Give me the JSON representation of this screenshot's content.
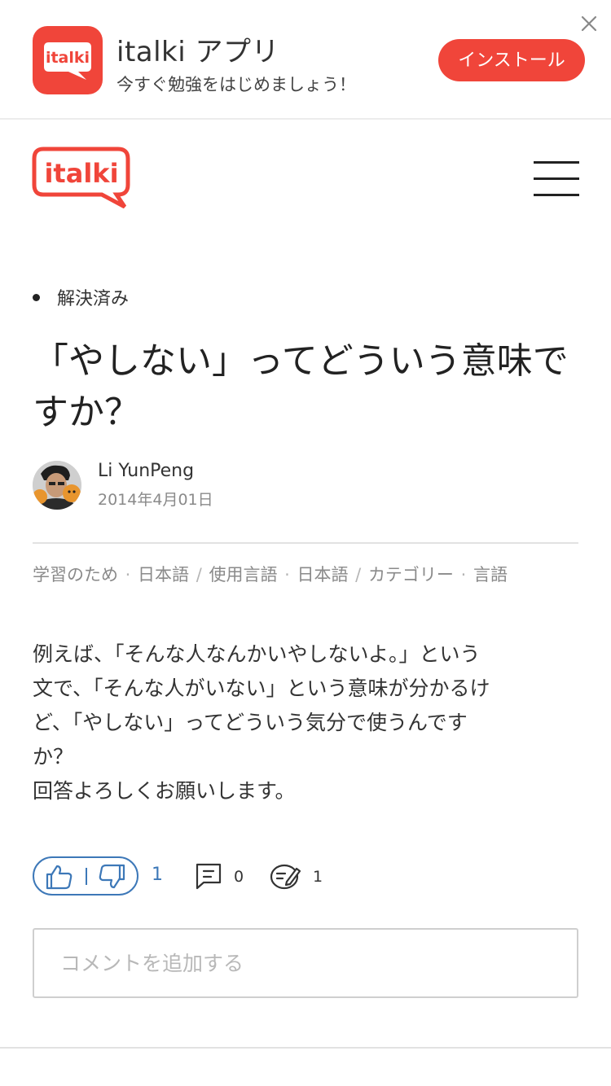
{
  "app_banner": {
    "icon_text": "italki",
    "title": "italki アプリ",
    "subtitle": "今すぐ勉強をはじめましょう！",
    "install_label": "インストール",
    "close_icon": "close-icon"
  },
  "header": {
    "logo_text": "italki",
    "menu_icon": "hamburger-menu-icon"
  },
  "post": {
    "status": "解決済み",
    "title": "「やしない」ってどういう意味ですか？",
    "author": {
      "name": "Li YunPeng",
      "date": "2014年4月01日"
    },
    "tags": {
      "purpose": "学習のため",
      "language": "日本語",
      "used_label": "使用言語",
      "used_language": "日本語",
      "category_label": "カテゴリー",
      "category": "言語"
    },
    "body_lines": [
      "例えば、「そんな人なんかいやしないよ。」という",
      "文で、「そんな人がいない」という意味が分かるけ",
      "ど、「やしない」ってどういう気分で使うんです",
      "か？",
      "回答よろしくお願いします。"
    ],
    "actions": {
      "vote_count": "1",
      "comment_count": "0",
      "edit_count": "1"
    },
    "comment_placeholder": "コメントを追加する"
  },
  "colors": {
    "brand_red": "#f0453a",
    "link_blue": "#3d78b8",
    "divider": "#e2e2e2"
  }
}
